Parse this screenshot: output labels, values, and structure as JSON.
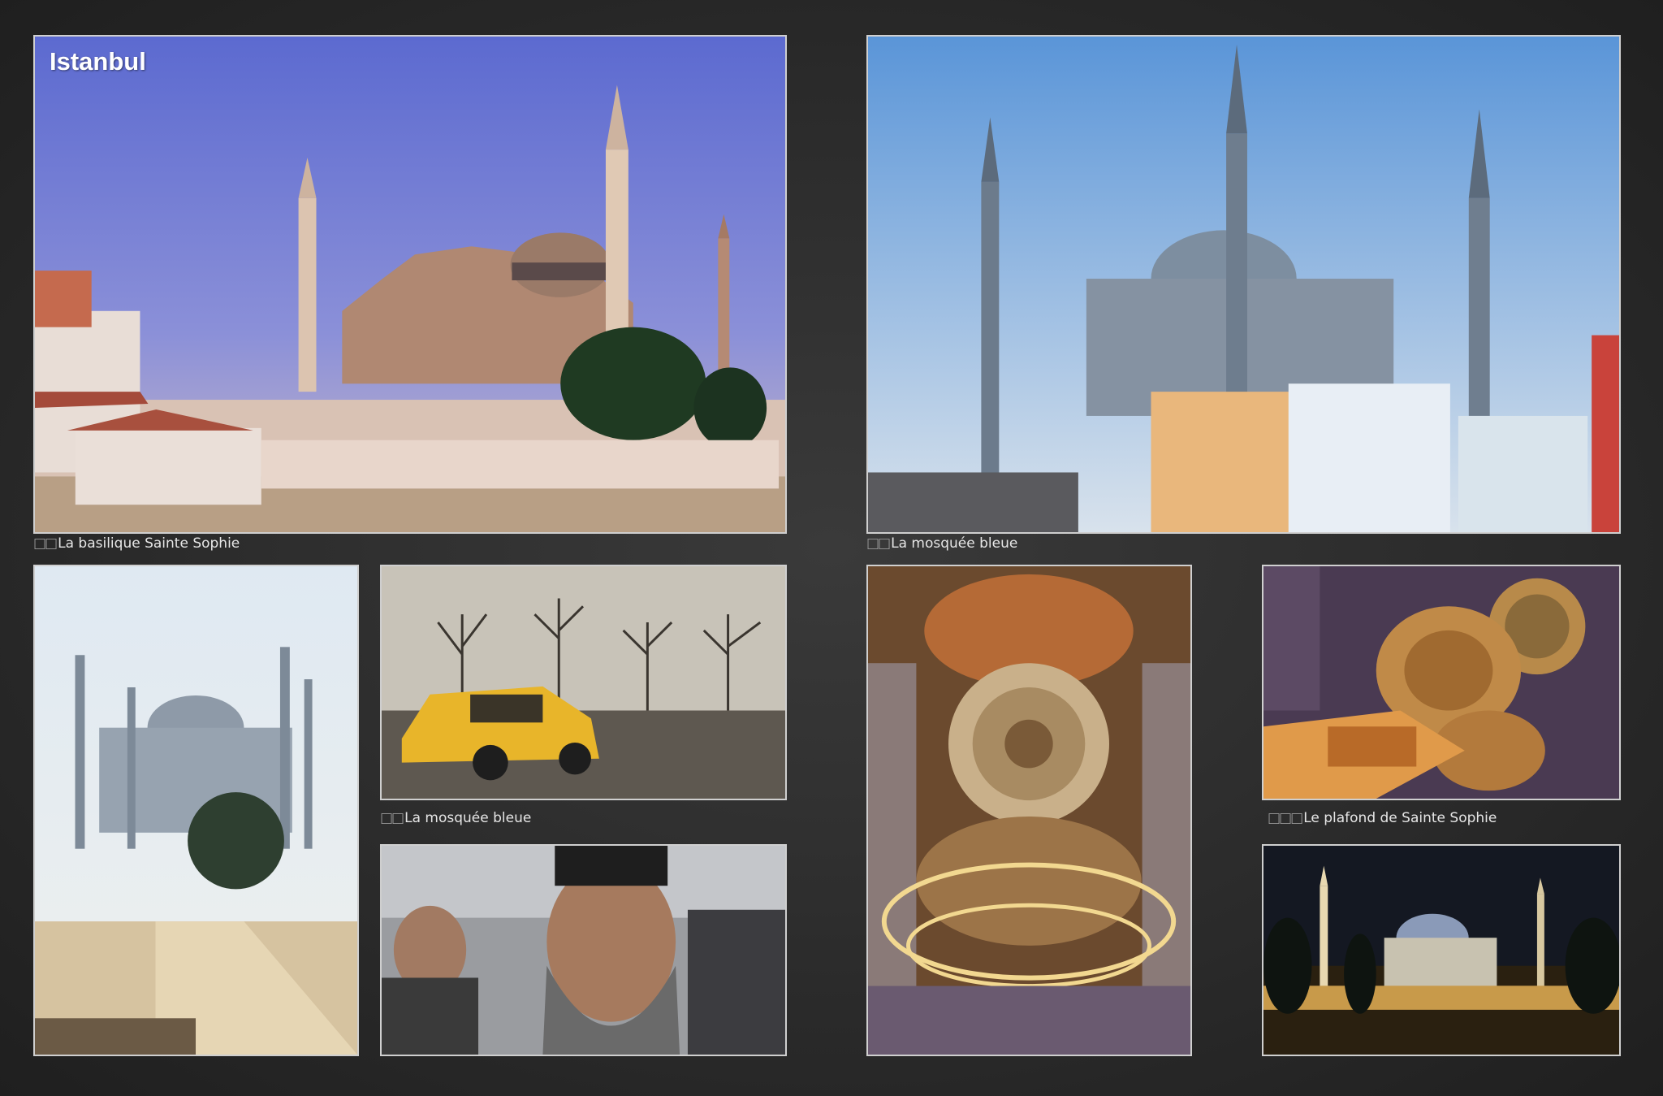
{
  "album": {
    "title": "Istanbul"
  },
  "captions": {
    "hagia_sophia": "La basilique Sainte Sophie",
    "blue_mosque_top": "La mosquée bleue",
    "blue_mosque_street": "La mosquée bleue",
    "ceiling": "Le plafond de Sainte Sophie"
  },
  "caption_marks": {
    "two": "□□",
    "three": "□□□"
  },
  "photos": [
    {
      "name": "hagia-sophia-photo",
      "subject": "Hagia Sophia exterior with minarets under blue sky"
    },
    {
      "name": "blue-mosque-photo",
      "subject": "Blue Mosque with six minarets above city buildings"
    },
    {
      "name": "blue-mosque-park-photo",
      "subject": "Blue Mosque in hazy light from park walkway"
    },
    {
      "name": "yellow-taxi-photo",
      "subject": "Yellow taxi in square with bare trees"
    },
    {
      "name": "bearded-man-photo",
      "subject": "Portrait of bearded man in crowd"
    },
    {
      "name": "dome-interior-photo",
      "subject": "Hagia Sophia dome interior with chandelier"
    },
    {
      "name": "ceiling-photo",
      "subject": "Sainte Sophie ceiling domes"
    },
    {
      "name": "night-mosque-photo",
      "subject": "Mosque illuminated at night"
    }
  ],
  "colors": {
    "background": "#2b2b2b",
    "frame": "#cfcfcf",
    "caption_text": "#e6e6e6"
  }
}
